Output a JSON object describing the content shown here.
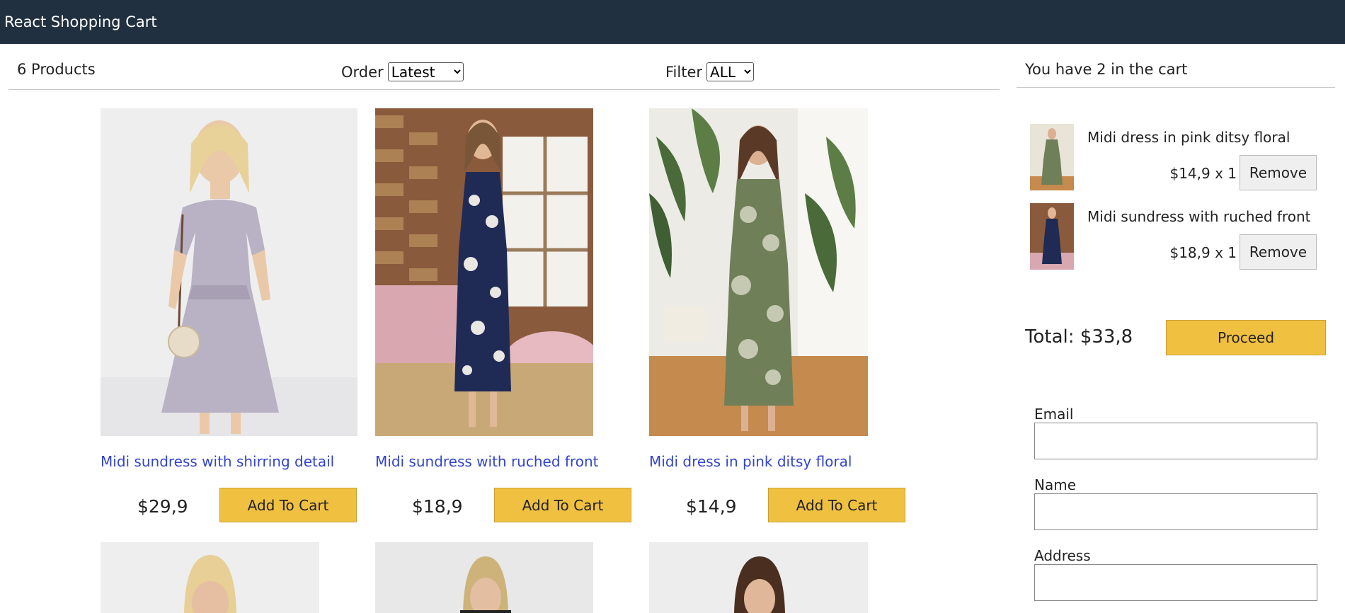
{
  "app": {
    "title": "React Shopping Cart"
  },
  "filter_bar": {
    "count_label": "6 Products",
    "order_label": "Order",
    "order_selected": "Latest",
    "filter_label": "Filter",
    "filter_selected": "ALL"
  },
  "products": [
    {
      "title": "Midi sundress with shirring detail",
      "price": "$29,9",
      "button": "Add To Cart"
    },
    {
      "title": "Midi sundress with ruched front",
      "price": "$18,9",
      "button": "Add To Cart"
    },
    {
      "title": "Midi dress in pink ditsy floral",
      "price": "$14,9",
      "button": "Add To Cart"
    }
  ],
  "cart": {
    "header": "You have 2 in the cart",
    "items": [
      {
        "title": "Midi dress in pink ditsy floral",
        "qty_price": "$14,9 x 1",
        "remove": "Remove"
      },
      {
        "title": "Midi sundress with ruched front",
        "qty_price": "$18,9 x 1",
        "remove": "Remove"
      }
    ],
    "total": "Total: $33,8",
    "proceed": "Proceed"
  },
  "checkout_form": {
    "email_label": "Email",
    "name_label": "Name",
    "address_label": "Address"
  },
  "colors": {
    "topbar": "#203040",
    "accent_button": "#f0c040",
    "product_title": "#3344cc"
  }
}
